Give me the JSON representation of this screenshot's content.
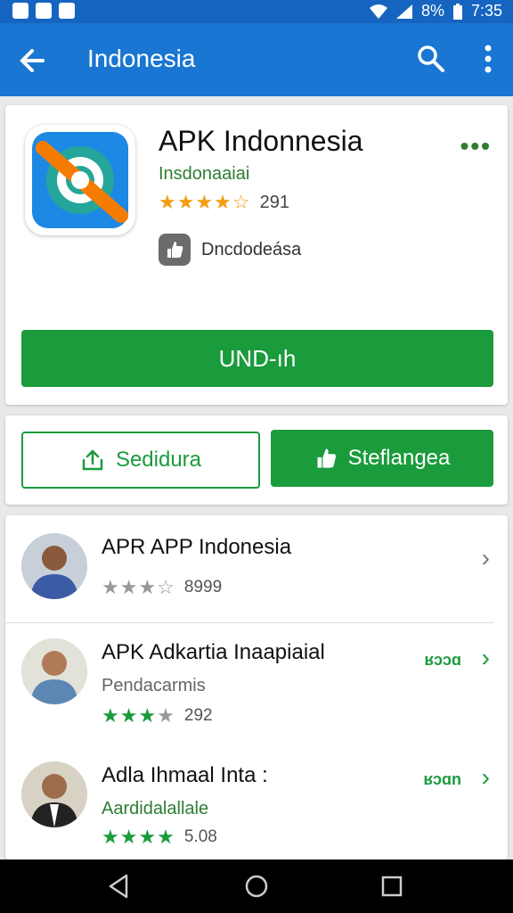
{
  "status_bar": {
    "battery": "8%",
    "time": "7:35"
  },
  "app_bar": {
    "title": "Indonesia"
  },
  "app": {
    "title": "APK Indonnesia",
    "developer": "Insdonaaiai",
    "rating": "291",
    "content_rating": "Dncdodeása",
    "install_label": "UND-ıh"
  },
  "actions": {
    "secondary_label": "Sedidura",
    "primary_label": "Steflangea"
  },
  "list": [
    {
      "title": "APR APP Indonesia",
      "subtitle": "",
      "rating": "8999",
      "badge": ""
    },
    {
      "title": "APK Adkartia Inaapiaial",
      "subtitle": "Pendacarmis",
      "rating": "292",
      "badge": "ʁɔɔɑ"
    },
    {
      "title": "Adla Ihmaal Inta :",
      "subtitle": "Aardidalallale",
      "rating": "5.08",
      "badge": "ʁɔɑn"
    }
  ],
  "colors": {
    "status_bar": "#1565c0",
    "app_bar": "#1976d2",
    "accent_green": "#1a9b3c",
    "star_orange": "#f39c12"
  }
}
